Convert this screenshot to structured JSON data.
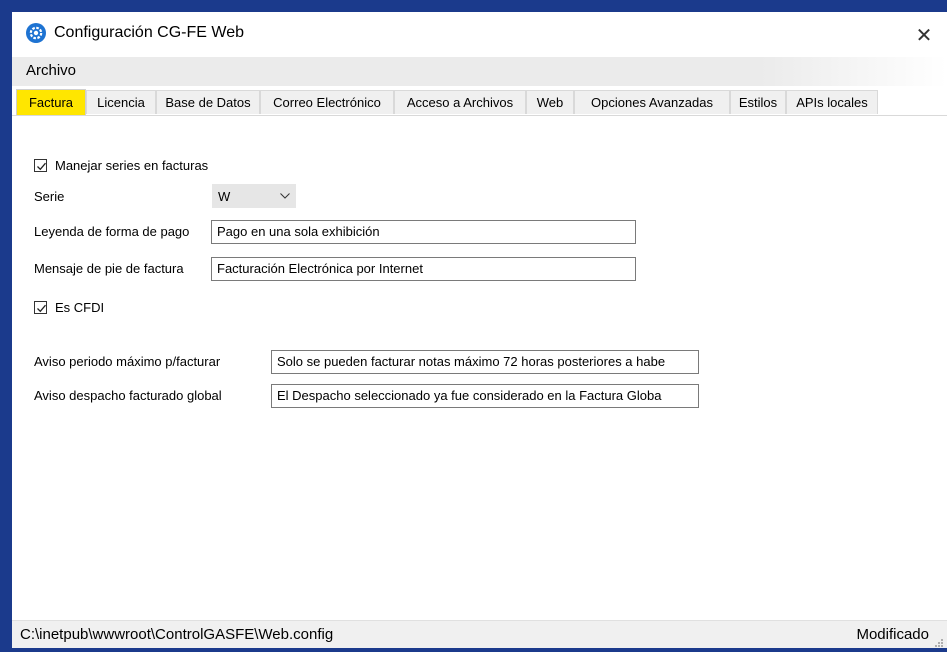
{
  "window": {
    "title": "Configuración CG-FE Web",
    "close_symbol": "✕"
  },
  "menu": {
    "items": [
      "Archivo"
    ]
  },
  "tabs": [
    {
      "label": "Factura",
      "active": true
    },
    {
      "label": "Licencia",
      "active": false
    },
    {
      "label": "Base de Datos",
      "active": false
    },
    {
      "label": "Correo Electrónico",
      "active": false
    },
    {
      "label": "Acceso a Archivos",
      "active": false
    },
    {
      "label": "Web",
      "active": false
    },
    {
      "label": "Opciones Avanzadas",
      "active": false
    },
    {
      "label": "Estilos",
      "active": false
    },
    {
      "label": "APIs locales",
      "active": false
    }
  ],
  "form": {
    "manejar_series": {
      "label": "Manejar series en facturas",
      "checked": true
    },
    "serie": {
      "label": "Serie",
      "value": "W"
    },
    "leyenda_pago": {
      "label": "Leyenda de forma de pago",
      "value": "Pago en una sola exhibición"
    },
    "mensaje_pie": {
      "label": "Mensaje de pie de factura",
      "value": "Facturación Electrónica por Internet"
    },
    "es_cfdi": {
      "label": "Es CFDI",
      "checked": true
    },
    "aviso_periodo": {
      "label": "Aviso periodo máximo p/facturar",
      "value": "Solo se pueden facturar notas máximo 72 horas posteriores a habe"
    },
    "aviso_despacho": {
      "label": "Aviso despacho facturado global",
      "value": "El Despacho seleccionado ya fue considerado en la Factura Globa"
    }
  },
  "status": {
    "path": "C:\\inetpub\\wwwroot\\ControlGASFE\\Web.config",
    "state": "Modificado"
  },
  "colors": {
    "active_tab": "#ffe600",
    "app_icon": "#1e73d2",
    "desktop": "#1b3a8c"
  },
  "icons": {
    "app": "gear-icon",
    "close": "close-icon",
    "dropdown": "chevron-down-icon",
    "check": "check-icon",
    "grip": "resize-grip-icon"
  }
}
